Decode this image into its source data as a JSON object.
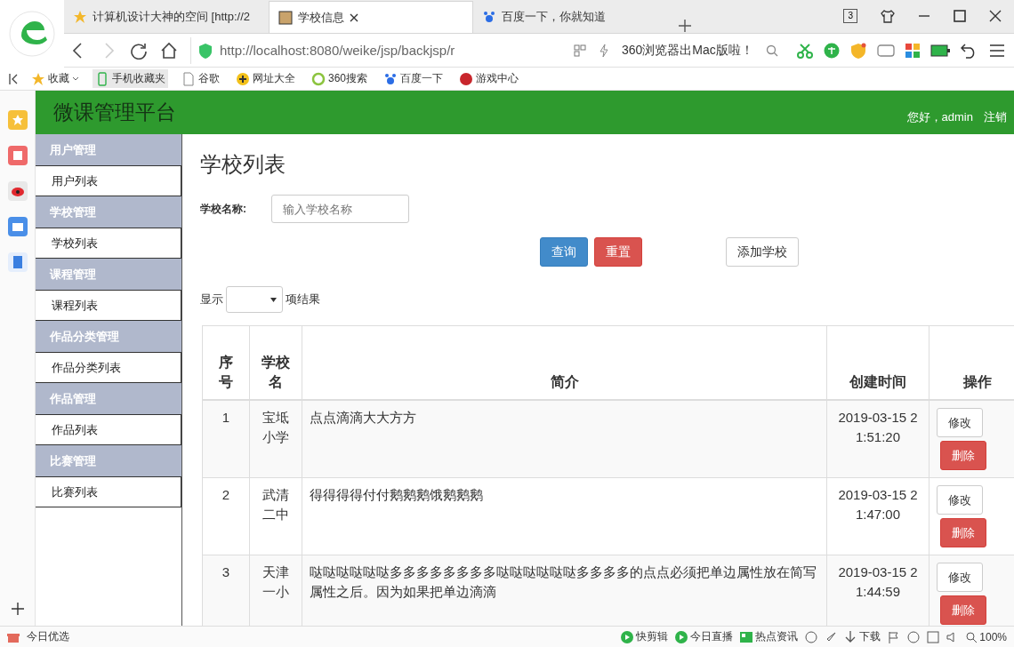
{
  "browser": {
    "tabs": [
      {
        "title": "计算机设计大神的空间 [http://2",
        "selected": false
      },
      {
        "title": "学校信息",
        "selected": true
      },
      {
        "title": "百度一下，你就知道",
        "selected": false
      }
    ],
    "tab_count": "3",
    "address": "http://localhost:8080/weike/jsp/backjsp/r",
    "promo": "360浏览器出Mac版啦！",
    "bookmarks": [
      "收藏",
      "手机收藏夹",
      "谷歌",
      "网址大全",
      "360搜索",
      "百度一下",
      "游戏中心"
    ]
  },
  "app": {
    "title": "微课管理平台",
    "greeting": "您好，admin",
    "logout": "注销",
    "sidebar": [
      {
        "title": "用户管理",
        "items": [
          "用户列表"
        ]
      },
      {
        "title": "学校管理",
        "items": [
          "学校列表"
        ]
      },
      {
        "title": "课程管理",
        "items": [
          "课程列表"
        ]
      },
      {
        "title": "作品分类管理",
        "items": [
          "作品分类列表"
        ]
      },
      {
        "title": "作品管理",
        "items": [
          "作品列表"
        ]
      },
      {
        "title": "比赛管理",
        "items": [
          "比赛列表"
        ]
      }
    ],
    "heading": "学校列表",
    "filter": {
      "label": "学校名称:",
      "placeholder": "输入学校名称"
    },
    "buttons": [
      {
        "label": "查询",
        "kind": "primary"
      },
      {
        "label": "重置",
        "kind": "danger"
      },
      {
        "label": "添加学校",
        "kind": "default"
      }
    ],
    "page_size": {
      "before": "显示",
      "after": "项结果"
    },
    "table": {
      "columns": [
        "序号",
        "学校名",
        "简介",
        "创建时间",
        "操作"
      ],
      "rows": [
        {
          "cells": [
            "1",
            "宝坻小学",
            "点点滴滴大大方方",
            "2019-03-15 21:51:20"
          ],
          "actions": [
            {
              "label": "修改",
              "kind": "default"
            },
            {
              "label": "删除",
              "kind": "danger"
            }
          ]
        },
        {
          "cells": [
            "2",
            "武清二中",
            "得得得得付付鹅鹅鹅饿鹅鹅鹅",
            "2019-03-15 21:47:00"
          ],
          "actions": [
            {
              "label": "修改",
              "kind": "default"
            },
            {
              "label": "删除",
              "kind": "danger"
            }
          ]
        },
        {
          "cells": [
            "3",
            "天津一小",
            "哒哒哒哒哒哒多多多多多多多多哒哒哒哒哒哒多多多多的点点必须把单边属性放在简写属性之后。因为如果把单边滴滴",
            "2019-03-15 21:44:59"
          ],
          "actions": [
            {
              "label": "修改",
              "kind": "default"
            },
            {
              "label": "删除",
              "kind": "danger"
            }
          ]
        }
      ]
    }
  },
  "status_bar": {
    "left": "今日优选",
    "items": [
      "快剪辑",
      "今日直播",
      "热点资讯",
      "下载"
    ],
    "zoom": "100%"
  }
}
